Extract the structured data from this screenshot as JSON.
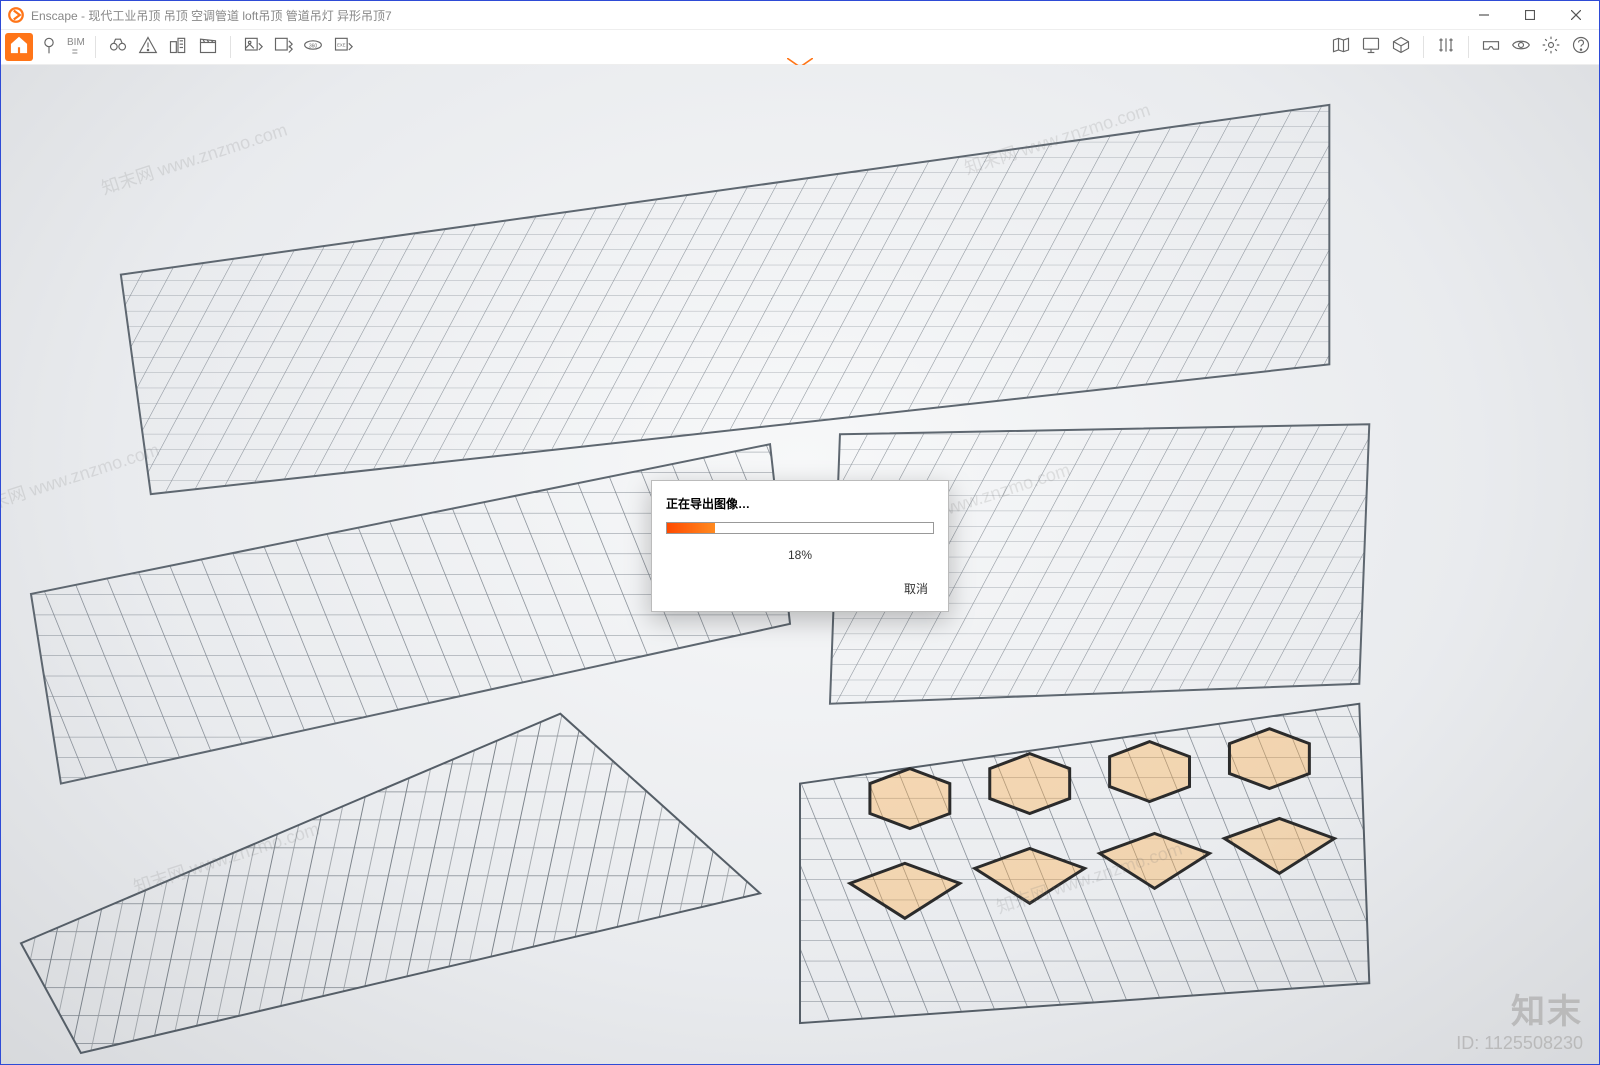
{
  "window": {
    "app_name": "Enscape",
    "title": "Enscape - 现代工业吊顶 吊顶 空调管道 loft吊顶 管道吊灯 异形吊顶7"
  },
  "controls": {
    "minimize_name": "minimize",
    "maximize_name": "maximize",
    "close_name": "close"
  },
  "toolbar": {
    "bim_label": "BIM",
    "bim_sub": "≡",
    "left_icons": [
      "home",
      "pin",
      "bim",
      "binoculars",
      "triangle",
      "buildings",
      "clapper",
      "export-right",
      "export-arrow",
      "panorama-360",
      "exe-export"
    ],
    "right_icons": [
      "map",
      "monitor",
      "cube",
      "divider",
      "columns",
      "divider",
      "vr-headset",
      "eye",
      "gear",
      "help"
    ]
  },
  "dialog": {
    "title": "正在导出图像…",
    "progress_percent": 18,
    "progress_label": "18%",
    "cancel_label": "取消"
  },
  "watermark": {
    "text": "知末网 www.znzmo.com",
    "corner_brand": "知末",
    "corner_id": "ID: 1125508230"
  }
}
